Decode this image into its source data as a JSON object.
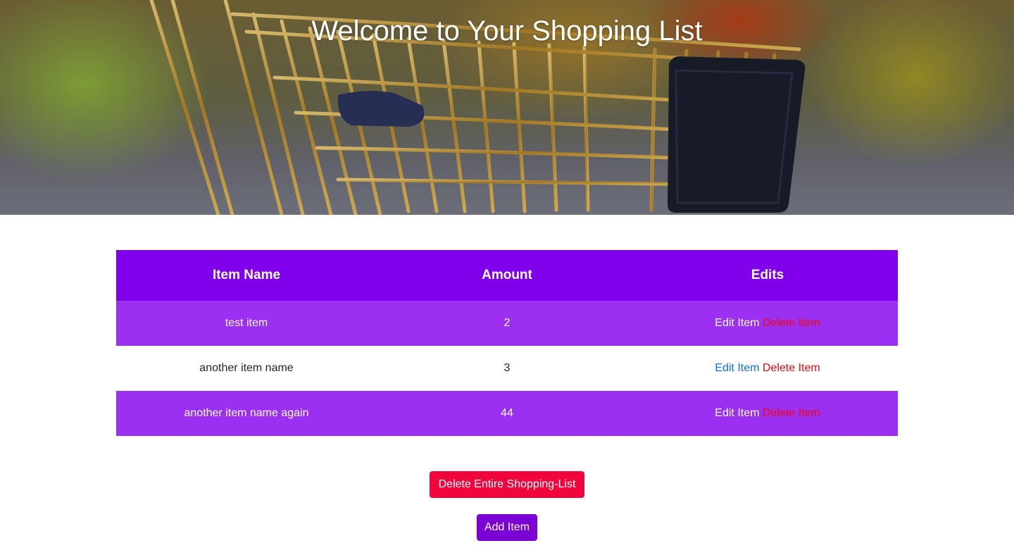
{
  "hero": {
    "title": "Welcome to Your Shopping List"
  },
  "table": {
    "headers": [
      "Item Name",
      "Amount",
      "Edits"
    ],
    "rows": [
      {
        "name": "test item",
        "amount": "2",
        "edit_label": "Edit Item",
        "delete_label": "Delete Item"
      },
      {
        "name": "another item name",
        "amount": "3",
        "edit_label": "Edit Item",
        "delete_label": "Delete Item"
      },
      {
        "name": "another item name again",
        "amount": "44",
        "edit_label": "Edit Item",
        "delete_label": "Delete Item"
      }
    ]
  },
  "actions": {
    "delete_all_label": "Delete Entire Shopping-List",
    "add_item_label": "Add Item"
  },
  "colors": {
    "header_bg": "#8000ec",
    "row_accent_bg": "#9b30f3",
    "delete_text": "#f00a0a",
    "edit_link": "#0d6efd",
    "delete_all_button": "#f0063c",
    "add_button": "#7b00d6"
  }
}
